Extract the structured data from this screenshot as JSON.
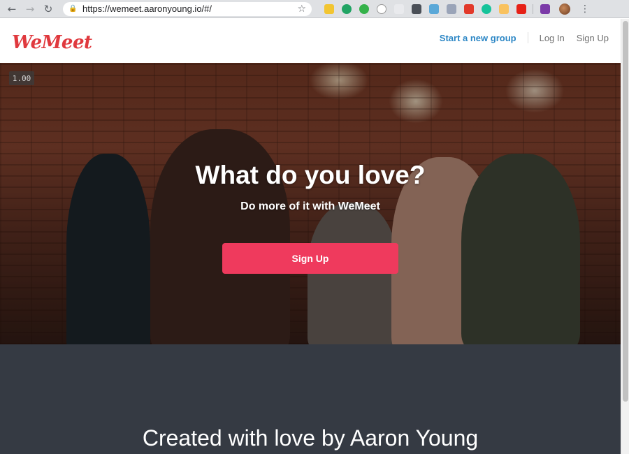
{
  "browser": {
    "url": "https://wemeet.aaronyoung.io/#/",
    "extensions": [
      {
        "icon": "notes-extension-icon",
        "color": "#f2c531"
      },
      {
        "icon": "hangouts-extension-icon",
        "color": "#21a464"
      },
      {
        "icon": "id-extension-icon",
        "color": "#35b24a"
      },
      {
        "icon": "circle-extension-icon",
        "color": "#ffffff"
      },
      {
        "icon": "doc-extension-icon",
        "color": "#e9eaed"
      },
      {
        "icon": "pocket-extension-icon",
        "color": "#4a4f57"
      },
      {
        "icon": "react-extension-icon",
        "color": "#5aa8d8"
      },
      {
        "icon": "dev-extension-icon",
        "color": "#9aa4b8"
      },
      {
        "icon": "stack-extension-icon",
        "color": "#e2392a"
      },
      {
        "icon": "grammarly-extension-icon",
        "color": "#15c39a"
      },
      {
        "icon": "spark-extension-icon",
        "color": "#f9c25f"
      },
      {
        "icon": "youtube-extension-icon",
        "color": "#e62117"
      },
      {
        "icon": "onenote-extension-icon",
        "color": "#7b3aa8"
      }
    ]
  },
  "header": {
    "logo": "WeMeet",
    "nav": {
      "start_group": "Start a new group",
      "login": "Log In",
      "signup": "Sign Up"
    }
  },
  "hero": {
    "zoom": "1.00",
    "title": "What do you love?",
    "subtitle": "Do more of it with WeMeet",
    "cta": "Sign Up"
  },
  "footer": {
    "credit": "Created with love by Aaron Young"
  },
  "colors": {
    "brand": "#e0393e",
    "cta": "#ef3a5d",
    "link": "#2b86c5",
    "footer_bg": "#353a43"
  }
}
